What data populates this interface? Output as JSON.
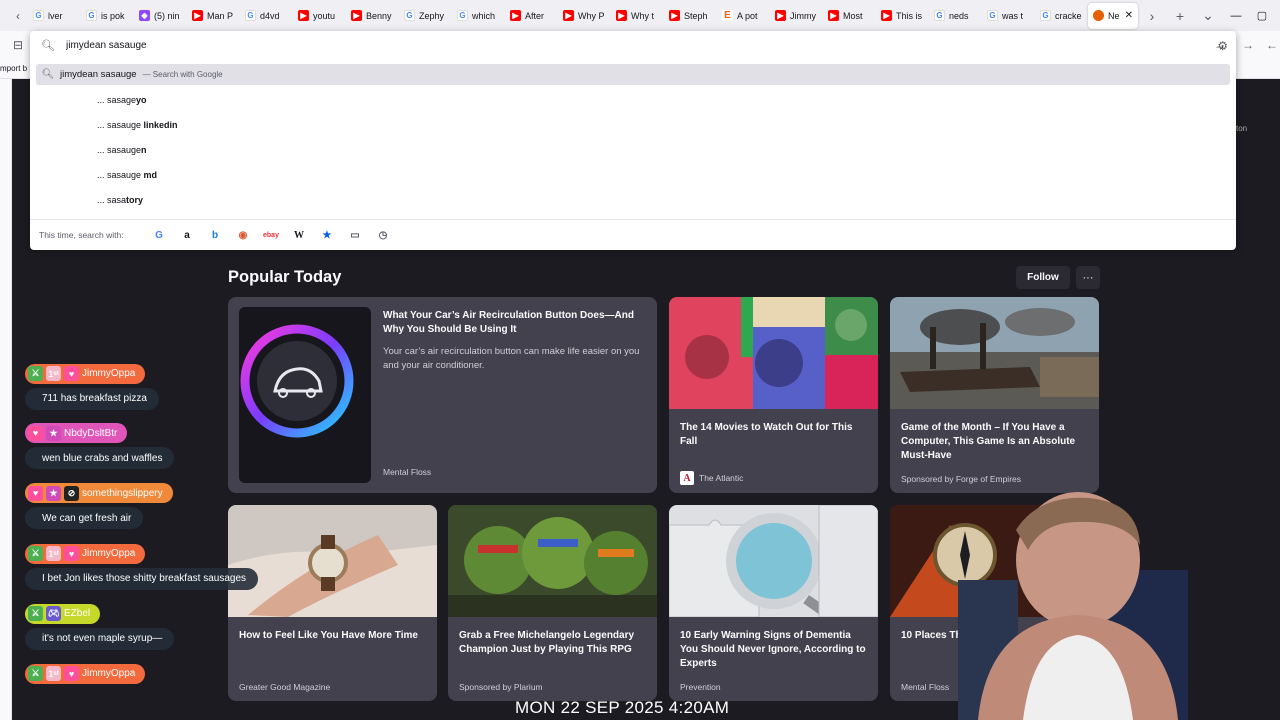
{
  "tabs": [
    {
      "title": "lver",
      "favicon": "g"
    },
    {
      "title": "is pok",
      "favicon": "g"
    },
    {
      "title": "(5) nin",
      "favicon": "tw"
    },
    {
      "title": "Man P",
      "favicon": "yt"
    },
    {
      "title": "d4vd",
      "favicon": "g"
    },
    {
      "title": "youtu",
      "favicon": "yt"
    },
    {
      "title": "Benny",
      "favicon": "yt"
    },
    {
      "title": "Zephy",
      "favicon": "g"
    },
    {
      "title": "which",
      "favicon": "g"
    },
    {
      "title": "After",
      "favicon": "yt"
    },
    {
      "title": "Why P",
      "favicon": "yt"
    },
    {
      "title": "Why t",
      "favicon": "yt"
    },
    {
      "title": "Steph",
      "favicon": "yt"
    },
    {
      "title": "A pot",
      "favicon": "etsy"
    },
    {
      "title": "Jimmy",
      "favicon": "yt"
    },
    {
      "title": "Most",
      "favicon": "yt"
    },
    {
      "title": "This is",
      "favicon": "yt"
    },
    {
      "title": "neds",
      "favicon": "g"
    },
    {
      "title": "was t",
      "favicon": "g"
    },
    {
      "title": "cracke",
      "favicon": "g"
    }
  ],
  "active_tab": {
    "title": "Ne",
    "favicon": "ff"
  },
  "import_bookmarks": "mport b",
  "behind_text": "ton",
  "urlbar": {
    "query": "jimydean sasauge",
    "selected_result": {
      "text": "jimydean sasauge",
      "suffix": "— Search with Google"
    },
    "suggestions": [
      {
        "prefix": "... sasage",
        "bold": "yo"
      },
      {
        "prefix": "... sasauge ",
        "bold": "linkedin"
      },
      {
        "prefix": "... sasauge",
        "bold": "n"
      },
      {
        "prefix": "... sasauge ",
        "bold": "md"
      },
      {
        "prefix": "... sasa",
        "bold": "tory"
      }
    ],
    "oneoff_label": "This time, search with:"
  },
  "section": {
    "title": "Popular Today",
    "follow_label": "Follow",
    "more_label": "···"
  },
  "cards": [
    {
      "title": "What Your Car’s Air Recirculation Button Does—And Why You Should Be Using It",
      "excerpt": "Your car’s air recirculation button can make life easier on you and your air conditioner.",
      "source": "Mental Floss"
    },
    {
      "title": "The 14 Movies to Watch Out for This Fall",
      "source": "The Atlantic",
      "source_icon": "A"
    },
    {
      "title": "Game of the Month – If You Have a Computer, This Game Is an Absolute Must-Have",
      "source": "Sponsored by Forge of Empires"
    },
    {
      "title": "How to Feel Like You Have More Time",
      "source": "Greater Good Magazine"
    },
    {
      "title": "Grab a Free Michelangelo Legendary Champion Just by Playing This RPG",
      "source": "Sponsored by Plarium"
    },
    {
      "title": "10 Early Warning Signs of Dementia You Should Never Ignore, According to Experts",
      "source": "Prevention"
    },
    {
      "title": "10 Places That",
      "source": "Mental Floss"
    }
  ],
  "chat": [
    {
      "user": "JimmyOppa",
      "message": "711 has breakfast pizza",
      "color": "#f26a3d",
      "badges": [
        "sword",
        "1st",
        "heart"
      ]
    },
    {
      "user": "NbdyDsltBtr",
      "message": "wen blue crabs and waffles",
      "color": "#e056b8",
      "badges": [
        "heart",
        "star"
      ]
    },
    {
      "user": "somethingslippery",
      "message": "We can get fresh air",
      "color": "#f08a3a",
      "badges": [
        "heart",
        "star",
        "no"
      ]
    },
    {
      "user": "JimmyOppa",
      "message": "I bet Jon likes those shitty breakfast sausages",
      "color": "#f26a3d",
      "badges": [
        "sword",
        "1st",
        "heart"
      ]
    },
    {
      "user": "EZbel",
      "message": "it's not even maple syrup—",
      "color": "#c6d92a",
      "badges": [
        "sword",
        "controller"
      ]
    },
    {
      "user": "JimmyOppa",
      "message": "",
      "color": "#f26a3d",
      "badges": [
        "sword",
        "1st",
        "heart"
      ]
    }
  ],
  "clock": "MON 22 SEP 2025 4:20AM"
}
